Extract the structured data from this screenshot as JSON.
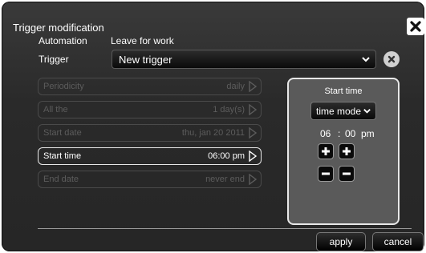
{
  "dialog": {
    "title": "Trigger modification",
    "close_icon": "close-icon"
  },
  "header": {
    "automation_label": "Automation",
    "automation_value": "Leave for work",
    "trigger_label": "Trigger",
    "trigger_value": "New trigger"
  },
  "rows": [
    {
      "label": "Periodicity",
      "value": "daily",
      "active": false
    },
    {
      "label": "All the",
      "value": "1 day(s)",
      "active": false
    },
    {
      "label": "Start date",
      "value": "thu, jan 20 2011",
      "active": false
    },
    {
      "label": "Start time",
      "value": "06:00 pm",
      "active": true
    },
    {
      "label": "End date",
      "value": "never end",
      "active": false
    }
  ],
  "panel": {
    "title": "Start time",
    "mode": "time mode",
    "hour": "06",
    "separator": ":",
    "minute": "00",
    "ampm": "pm"
  },
  "buttons": {
    "apply": "apply",
    "cancel": "cancel"
  },
  "colors": {
    "background": "#2a2a2a",
    "active_border": "#e8e8e8",
    "disabled_text": "#5c5c5c"
  }
}
